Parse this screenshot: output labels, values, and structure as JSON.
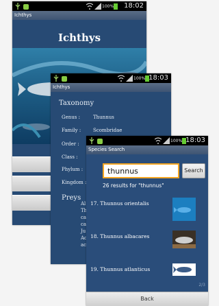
{
  "status_bar": {
    "time_1": "18:02",
    "time_2": "18:03",
    "time_3": "18:03",
    "battery": "100%"
  },
  "home_screen": {
    "app_title_bar": "Ichthys",
    "hero_title": "Ichthys"
  },
  "detail_screen": {
    "app_title_bar": "Ichthys",
    "taxonomy_heading": "Taxonomy",
    "taxonomy": [
      {
        "label": "Genus :",
        "value": "Thunnus"
      },
      {
        "label": "Family :",
        "value": "Scombridae"
      },
      {
        "label": "Order :",
        "value": ""
      },
      {
        "label": "Class :",
        "value": ""
      },
      {
        "label": "Phylum :",
        "value": ""
      },
      {
        "label": "Kingdom :",
        "value": ""
      }
    ],
    "preys_heading": "Preys",
    "preys_lines": [
      "Al",
      "Th",
      "ca",
      "ca",
      "Ju",
      "Ac",
      "aca"
    ]
  },
  "search_screen": {
    "title_bar": "Species Search",
    "query": "thunnus",
    "search_button": "Search",
    "results_count": "26 results for \"thunnus\"",
    "results": [
      {
        "label": "17. Thunnus orientalis",
        "thumb": "blue-fish-photo"
      },
      {
        "label": "18. Thunnus albacares",
        "thumb": "fish-on-deck-photo"
      },
      {
        "label": "19. Thunnus atlanticus",
        "thumb": "tuna-drawing"
      }
    ],
    "pager": "2/3",
    "back_button": "Back"
  }
}
